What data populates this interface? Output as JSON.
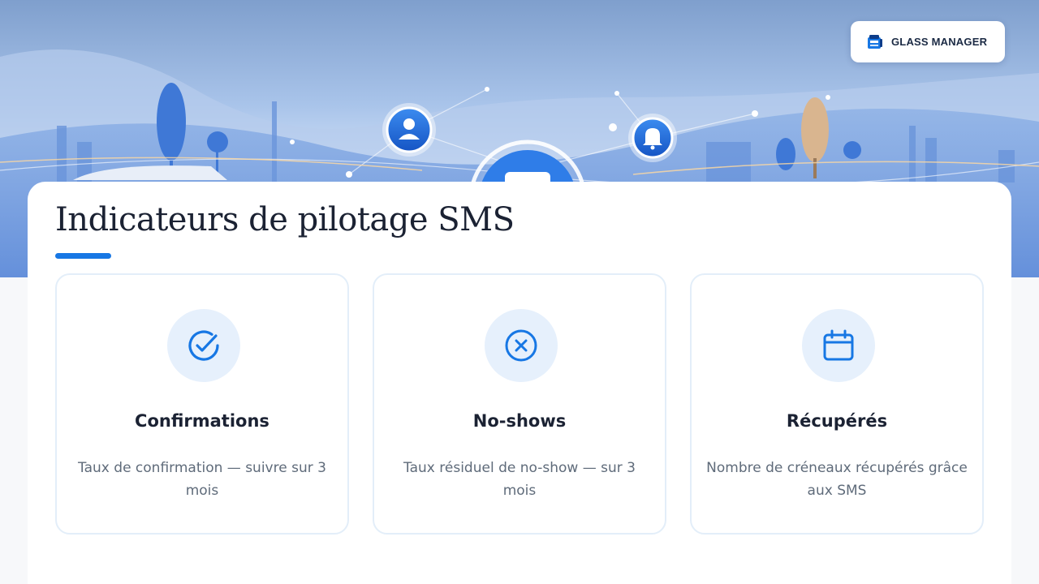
{
  "brand": {
    "name": "GLASS MANAGER",
    "logo_icon": "glass-manager-logo-icon"
  },
  "page": {
    "title": "Indicateurs de pilotage SMS"
  },
  "hero": {
    "nodes": [
      "user-icon",
      "bell-icon"
    ]
  },
  "colors": {
    "accent": "#1777e4",
    "card_border": "#e3eef9",
    "icon_bg": "#e6f0fc",
    "title": "#1b2233",
    "text_muted": "#5f6b7a"
  },
  "cards": [
    {
      "icon": "check-circle-icon",
      "title": "Confirmations",
      "description": "Taux de confirmation — suivre sur 3 mois"
    },
    {
      "icon": "x-circle-icon",
      "title": "No-shows",
      "description": "Taux résiduel de no-show — sur 3 mois"
    },
    {
      "icon": "calendar-icon",
      "title": "Récupérés",
      "description": "Nombre de créneaux récupérés grâce aux SMS"
    }
  ]
}
